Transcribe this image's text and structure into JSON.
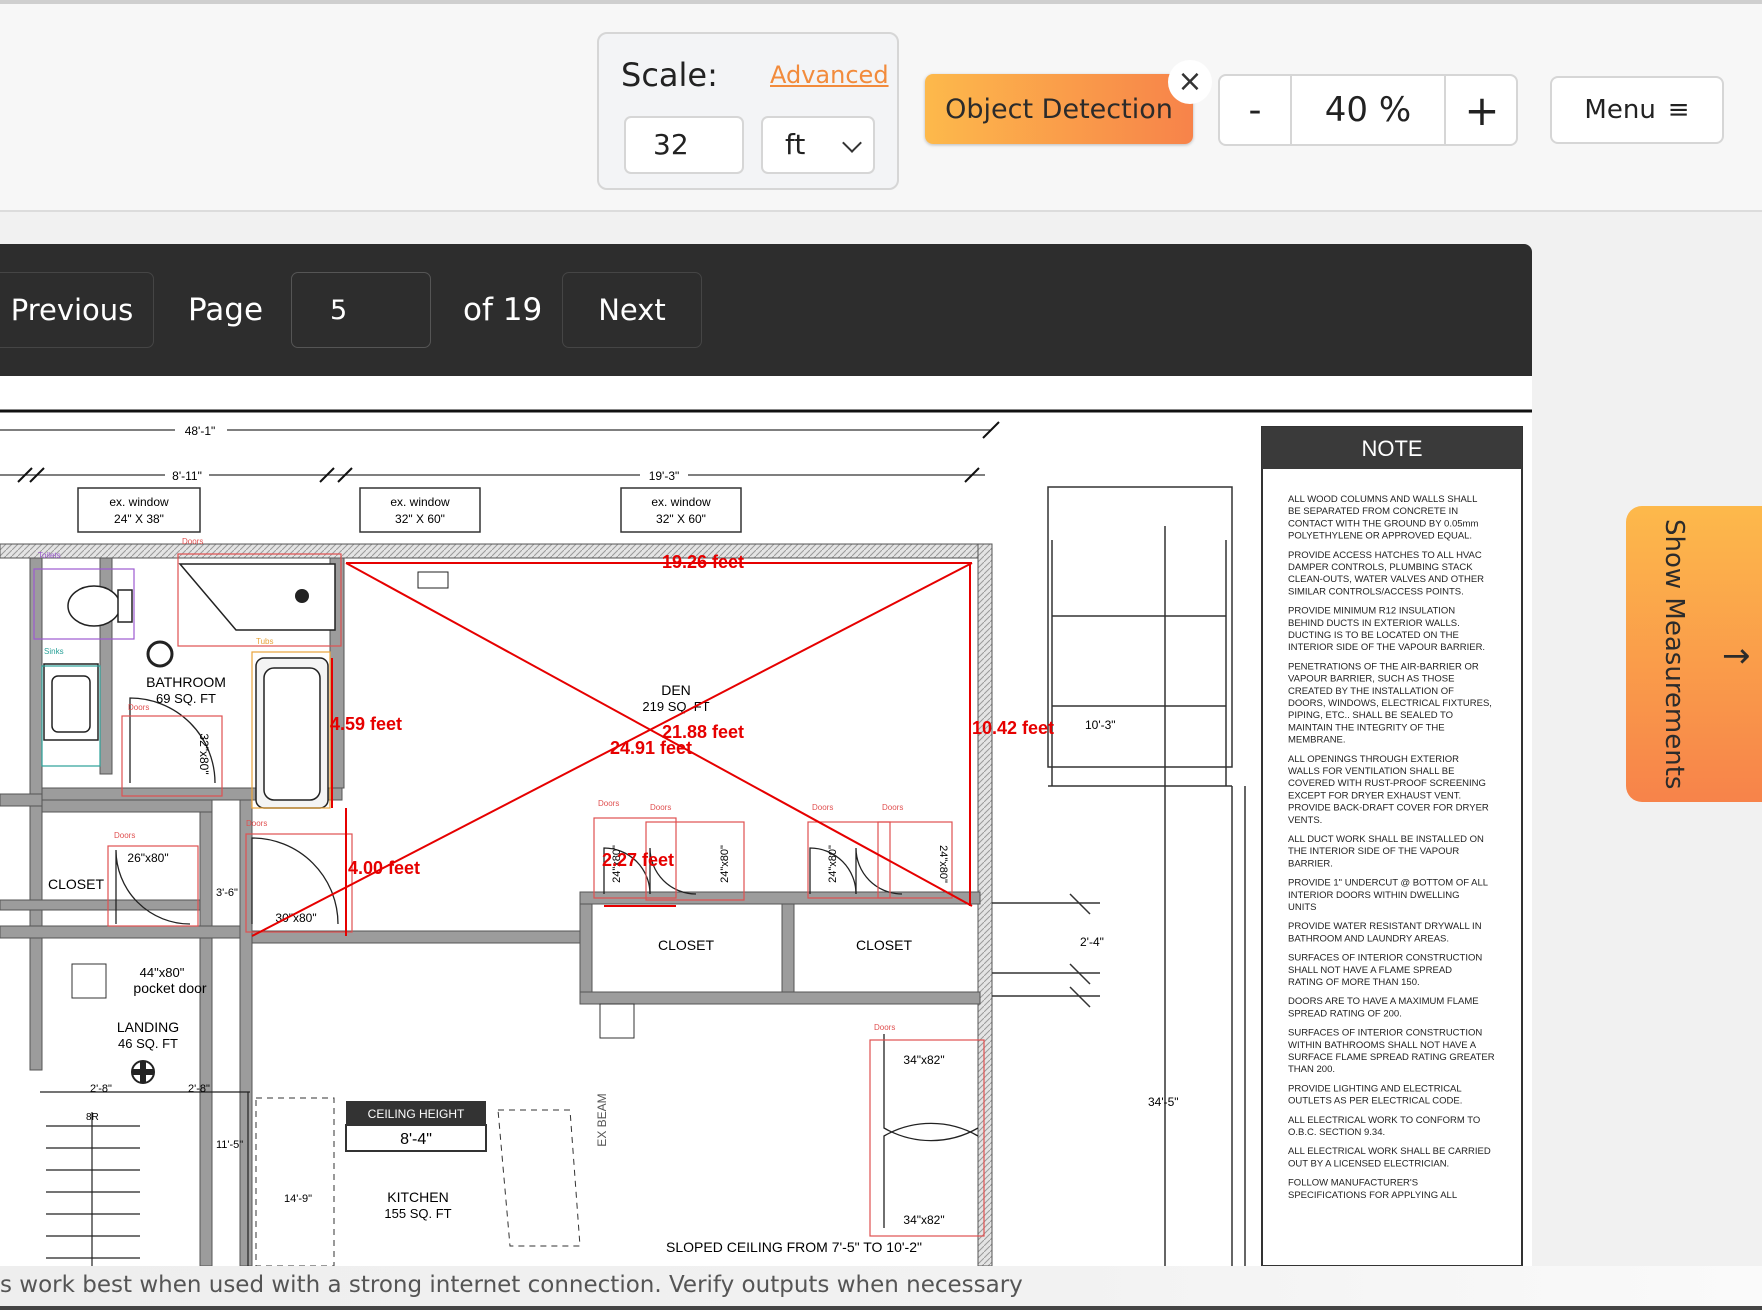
{
  "toolbar": {
    "scale_label": "Scale:",
    "advanced_link": "Advanced",
    "scale_value": "32",
    "unit_value": "ft",
    "object_detection_label": "Object Detection",
    "close_glyph": "×",
    "zoom_minus": "-",
    "zoom_value": "40 %",
    "zoom_plus": "+",
    "menu_label": "Menu",
    "menu_icon": "≡"
  },
  "pager": {
    "previous_label": "Previous",
    "page_label": "Page",
    "page_value": "5",
    "of_label": "of 19",
    "next_label": "Next"
  },
  "side_tab": {
    "label": "Show Measurements",
    "arrow": "→"
  },
  "footer": {
    "text": "s work best when used with a strong internet connection. Verify outputs when necessary"
  },
  "plan": {
    "dims": {
      "overall_top": "48'-1\"",
      "left_top": "8'-11\"",
      "right_top": "19'-3\"",
      "height_right": "10'-3\"",
      "side_a": "2'-4\"",
      "side_long": "34'-5\"",
      "stair_a": "2'-8\"",
      "stair_b": "2'-8\"",
      "stair_8r": "8R",
      "d_11_5": "11'-5\"",
      "d_14_9": "14'-9\"",
      "d_3_6": "3'-6\""
    },
    "windows": [
      {
        "line1": "ex. window",
        "line2": "24\" X 38\""
      },
      {
        "line1": "ex. window",
        "line2": "32\" X 60\""
      },
      {
        "line1": "ex. window",
        "line2": "32\" X 60\""
      }
    ],
    "rooms": {
      "bathroom": "BATHROOM",
      "bathroom_area": "69 SQ. FT",
      "den": "DEN",
      "den_area": "219 SQ. FT",
      "closet_left": "CLOSET",
      "closet_mid": "CLOSET",
      "closet_right": "CLOSET",
      "landing": "LANDING",
      "landing_area": "46 SQ. FT",
      "kitchen": "KITCHEN",
      "kitchen_area": "155 SQ. FT",
      "pocket_size": "44\"x80\"",
      "pocket_door": "pocket door",
      "ceiling_height_label": "CEILING HEIGHT",
      "ceiling_height_value": "8'-4\"",
      "ex_beam": "EX BEAM",
      "sloped": "SLOPED CEILING FROM 7'-5\" TO 10'-2\""
    },
    "door_sizes": {
      "d32x80": "32\"x80\"",
      "d26x80": "26\"x80\"",
      "d30x80": "30\"x80\"",
      "d24a": "24\"x80\"",
      "d24b": "24\"x80\"",
      "d24c": "24\"x80\"",
      "d24d": "24\"x80\"",
      "d34a": "34\"x82\"",
      "d34b": "34\"x82\""
    },
    "detections": {
      "toilets": "Toilets",
      "sinks": "Sinks",
      "tubs": "Tubs",
      "doors": "Doors"
    },
    "measurements": {
      "top": "19.26 feet",
      "tub_h": "4.59 feet",
      "right_h": "10.42 feet",
      "diag1": "21.88 feet",
      "diag2": "24.91 feet",
      "bottom_left": "4.00 feet",
      "small": "2.27 feet"
    },
    "note": {
      "title": "NOTE",
      "items": [
        [
          "ALL WOOD COLUMNS AND WALLS SHALL",
          "BE SEPARATED FROM CONCRETE IN",
          "CONTACT WITH THE GROUND BY 0.05mm",
          "POLYETHYLENE OR APPROVED EQUAL."
        ],
        [
          "PROVIDE ACCESS HATCHES TO ALL HVAC",
          "DAMPER CONTROLS, PLUMBING STACK",
          "CLEAN-OUTS, WATER VALVES AND OTHER",
          "SIMILAR CONTROLS/ACCESS POINTS."
        ],
        [
          "PROVIDE MINIMUM R12 INSULATION",
          "BEHIND DUCTS IN EXTERIOR WALLS.",
          "DUCTING IS TO BE LOCATED ON THE",
          "INTERIOR SIDE OF THE VAPOUR BARRIER."
        ],
        [
          "PENETRATIONS OF THE AIR-BARRIER OR",
          "VAPOUR BARRIER, SUCH AS THOSE",
          "CREATED BY THE INSTALLATION OF",
          "DOORS, WINDOWS, ELECTRICAL FIXTURES,",
          "PIPING, ETC.. SHALL BE SEALED TO",
          "MAINTAIN THE INTEGRITY OF THE",
          "MEMBRANE."
        ],
        [
          "ALL OPENINGS THROUGH EXTERIOR",
          "WALLS FOR VENTILATION SHALL BE",
          "COVERED WITH RUST-PROOF SCREENING",
          "EXCEPT FOR DRYER EXHAUST VENT.",
          "PROVIDE BACK-DRAFT COVER FOR DRYER",
          "VENTS."
        ],
        [
          "ALL DUCT WORK SHALL BE INSTALLED ON",
          "THE INTERIOR SIDE OF THE VAPOUR",
          "BARRIER."
        ],
        [
          "PROVIDE 1\" UNDERCUT @ BOTTOM OF ALL",
          "INTERIOR DOORS WITHIN DWELLING",
          "UNITS"
        ],
        [
          "PROVIDE WATER RESISTANT DRYWALL IN",
          "BATHROOM AND LAUNDRY AREAS."
        ],
        [
          "SURFACES OF INTERIOR CONSTRUCTION",
          "SHALL NOT HAVE A FLAME SPREAD",
          "RATING OF MORE THAN 150."
        ],
        [
          "DOORS ARE TO HAVE A MAXIMUM FLAME",
          "SPREAD RATING OF 200."
        ],
        [
          "SURFACES OF INTERIOR CONSTRUCTION",
          "WITHIN BATHROOMS SHALL NOT HAVE A",
          "SURFACE FLAME SPREAD RATING GREATER",
          "THAN 200."
        ],
        [
          "PROVIDE LIGHTING AND ELECTRICAL",
          "OUTLETS AS PER ELECTRICAL CODE."
        ],
        [
          "ALL ELECTRICAL WORK TO CONFORM TO",
          "O.B.C. SECTION 9.34."
        ],
        [
          "ALL ELECTRICAL WORK SHALL BE CARRIED",
          "OUT BY A LICENSED ELECTRICIAN."
        ],
        [
          "FOLLOW MANUFACTURER'S",
          "SPECIFICATIONS FOR APPLYING ALL"
        ]
      ]
    }
  },
  "colors": {
    "accent_start": "#fdb94b",
    "accent_end": "#f7834a",
    "measure_red": "#e60000",
    "pager_bg": "#2d2d2d"
  }
}
